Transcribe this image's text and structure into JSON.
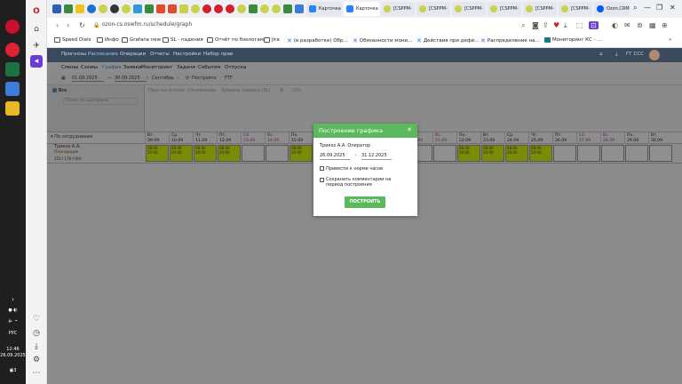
{
  "taskbar": {
    "lang": "РУС",
    "time": "12:46",
    "date": "26.09.2025",
    "notify_count": "3"
  },
  "tabs": [
    {
      "label": "Карточка"
    },
    {
      "label": "Карточка"
    },
    {
      "label": "[CSPPM-"
    },
    {
      "label": "[CSPPM-"
    },
    {
      "label": "[CSPPM-"
    },
    {
      "label": "[CSPPM-"
    },
    {
      "label": "[CSPPM-"
    },
    {
      "label": "[CSPPM-"
    },
    {
      "label": "Ozon.CRM"
    }
  ],
  "address": {
    "url": "ozon-cs.oswfm.ru/schedule/graph"
  },
  "bookmarks": [
    {
      "label": "Speed Dials"
    },
    {
      "label": "Инфо"
    },
    {
      "label": "Grafana new"
    },
    {
      "label": "SL - падения"
    },
    {
      "label": "Отчёт по бэклогам"
    },
    {
      "label": "Jira"
    },
    {
      "label": "(в разработке) Обр..."
    },
    {
      "label": "Обязанности мони..."
    },
    {
      "label": "Действия при дефи..."
    },
    {
      "label": "Распределение на..."
    },
    {
      "label": "Мониторинг КС - ..."
    }
  ],
  "app": {
    "nav": [
      "Прогнозы",
      "Расписание",
      "Операции",
      "Отчеты",
      "Настройки",
      "Набор прав"
    ],
    "nav_active_index": 1,
    "user_label": "ГГ ССС",
    "sub": [
      "Смены",
      "Схемы",
      "График",
      "Заявки",
      "Мониторинг",
      "Задачи",
      "События",
      "Отпуска"
    ],
    "sub_active_index": 2,
    "filter": {
      "date_from": "01.09.2025",
      "date_to": "30.09.2025",
      "month": "Сентябрь",
      "build_label": "Построить",
      "extra": "FTF"
    },
    "left_panel": {
      "all_label": "Все",
      "search_placeholder": "Поиск по критериям"
    },
    "right_top_tabs": [
      "Прогноз и план",
      "Отклонение",
      "Уровень сервиса (SL)",
      "Ф",
      "(20)"
    ],
    "group_label": "По сотрудникам",
    "employee": {
      "name": "Трикоз А.А.",
      "role": "Планирщик",
      "note": "152 / 176 (Ч/Н)"
    },
    "days": [
      {
        "d": "Вт.",
        "n": "09.09",
        "we": false
      },
      {
        "d": "Ср.",
        "n": "10.09",
        "we": false
      },
      {
        "d": "Чт.",
        "n": "11.09",
        "we": false
      },
      {
        "d": "Пт.",
        "n": "12.09",
        "we": false
      },
      {
        "d": "Сб.",
        "n": "13.09",
        "we": true
      },
      {
        "d": "Вс.",
        "n": "14.09",
        "we": true
      },
      {
        "d": "Пн.",
        "n": "15.09",
        "we": false
      },
      {
        "d": "Вт.",
        "n": "16.09",
        "we": false
      },
      {
        "d": "Ср.",
        "n": "17.09",
        "we": false
      },
      {
        "d": "Чт.",
        "n": "18.09",
        "we": false
      },
      {
        "d": "Пт.",
        "n": "19.09",
        "we": false
      },
      {
        "d": "Сб.",
        "n": "20.09",
        "we": true
      },
      {
        "d": "Вс.",
        "n": "21.09",
        "we": true
      },
      {
        "d": "Пн.",
        "n": "22.09",
        "we": false
      },
      {
        "d": "Вт.",
        "n": "23.09",
        "we": false
      },
      {
        "d": "Ср.",
        "n": "24.09",
        "we": false
      },
      {
        "d": "Чт.",
        "n": "25.09",
        "we": false
      },
      {
        "d": "Пт.",
        "n": "26.09",
        "we": false
      },
      {
        "d": "Сб.",
        "n": "27.09",
        "we": true
      },
      {
        "d": "Вс.",
        "n": "28.09",
        "we": true
      },
      {
        "d": "Пн.",
        "n": "29.09",
        "we": false
      },
      {
        "d": "Вт.",
        "n": "30.09",
        "we": false
      }
    ],
    "shift_cells": [
      {
        "t1": "08:00",
        "t2": "20:00",
        "on": true
      },
      {
        "t1": "08:00",
        "t2": "20:00",
        "on": true
      },
      {
        "t1": "08:00",
        "t2": "20:00",
        "on": true
      },
      {
        "t1": "08:00",
        "t2": "20:00",
        "on": true
      },
      {
        "t1": "",
        "t2": "",
        "on": false
      },
      {
        "t1": "",
        "t2": "",
        "on": false
      },
      {
        "t1": "08:00",
        "t2": "20:00",
        "on": true
      },
      {
        "t1": "08:00",
        "t2": "20:00",
        "on": true
      },
      {
        "t1": "08:00",
        "t2": "20:00",
        "on": true
      },
      {
        "t1": "08:00",
        "t2": "20:00",
        "on": true
      },
      {
        "t1": "08:00",
        "t2": "20:00",
        "on": true
      },
      {
        "t1": "",
        "t2": "",
        "on": false
      },
      {
        "t1": "",
        "t2": "",
        "on": false
      },
      {
        "t1": "08:00",
        "t2": "20:00",
        "on": true
      },
      {
        "t1": "08:00",
        "t2": "20:00",
        "on": true
      },
      {
        "t1": "08:00",
        "t2": "20:00",
        "on": true
      },
      {
        "t1": "08:00",
        "t2": "20:00",
        "on": true
      },
      {
        "t1": "",
        "t2": "",
        "on": false
      },
      {
        "t1": "",
        "t2": "",
        "on": false
      },
      {
        "t1": "",
        "t2": "",
        "on": false
      },
      {
        "t1": "",
        "t2": "",
        "on": false
      },
      {
        "t1": "",
        "t2": "",
        "on": false
      }
    ]
  },
  "modal": {
    "title": "Построение графика",
    "employee": "Трикоз А.А. Оператор",
    "date_from": "26.09.2025",
    "date_sep": "-",
    "date_to": "31.12.2025",
    "opt1": "Привести к норме часов",
    "opt2": "Сохранить комментарии на период построения",
    "build_button": "ПОСТРОИТЬ"
  },
  "colors": {
    "accent_green": "#5cb85c",
    "shift_green": "#7b8b08",
    "app_header": "#3a4a5c"
  }
}
